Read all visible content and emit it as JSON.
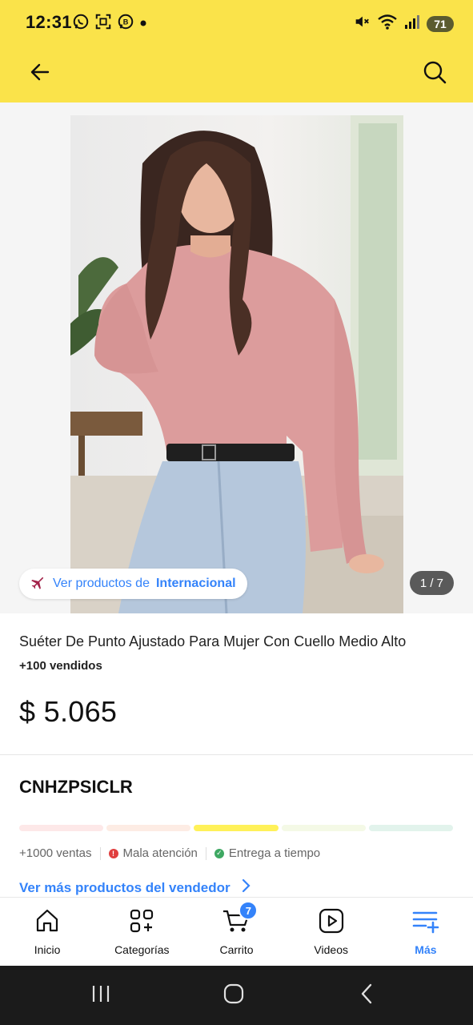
{
  "status_bar": {
    "time": "12:31",
    "battery": "71",
    "left_icons": [
      "whatsapp-icon",
      "scan-icon",
      "whatsapp-business-icon",
      "dot-icon"
    ],
    "right_icons": [
      "mute-icon",
      "wifi-icon",
      "signal-icon",
      "battery-icon"
    ]
  },
  "header": {
    "background_color": "#fae34a",
    "back_icon": "arrow-left-icon",
    "search_icon": "search-icon"
  },
  "gallery": {
    "chip_prefix": "Ver productos de",
    "chip_strong": "Internacional",
    "chip_icon": "airplane-icon",
    "counter": "1 / 7"
  },
  "product": {
    "title": "Suéter De Punto Ajustado Para Mujer Con Cuello Medio Alto",
    "sold": "+100 vendidos",
    "price": "$ 5.065"
  },
  "seller": {
    "name": "CNHZPSICLR",
    "reputation_colors": [
      "#fde8e8",
      "#fdece4",
      "#fff159",
      "#f4f9e6",
      "#e2f3ec"
    ],
    "reputation_active_index": 2,
    "sales": "+1000 ventas",
    "attention": "Mala atención",
    "delivery": "Entrega a tiempo",
    "more_link": "Ver más productos del vendedor"
  },
  "bottom_nav": {
    "items": [
      {
        "label": "Inicio",
        "icon": "home-icon"
      },
      {
        "label": "Categorías",
        "icon": "categories-icon"
      },
      {
        "label": "Carrito",
        "icon": "cart-icon",
        "badge": "7"
      },
      {
        "label": "Videos",
        "icon": "video-icon"
      },
      {
        "label": "Más",
        "icon": "more-menu-icon"
      }
    ],
    "active_index": 4,
    "accent": "#3483fa"
  },
  "system_nav": {
    "icons": [
      "recent-apps-icon",
      "home-circle-icon",
      "back-chevron-icon"
    ]
  }
}
